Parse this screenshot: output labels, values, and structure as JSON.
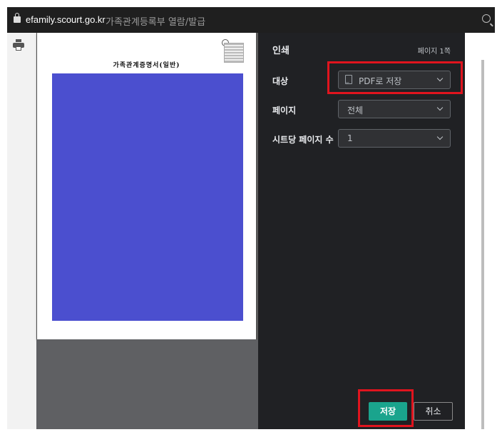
{
  "browser": {
    "url": "efamily.scourt.go.kr",
    "page_title": "가족관계등록부 열람/발급"
  },
  "preview": {
    "document_title": "가족관계증명서(일반)",
    "block_color": "#4b4fcf"
  },
  "print_dialog": {
    "heading": "인쇄",
    "page_count": "페이지 1쪽",
    "destination": {
      "label": "대상",
      "value": "PDF로 저장"
    },
    "pages": {
      "label": "페이지",
      "value": "전체"
    },
    "pages_per_sheet": {
      "label": "시트당 페이지 수",
      "value": "1"
    },
    "save_label": "저장",
    "cancel_label": "취소"
  },
  "colors": {
    "highlight": "#e0141e",
    "save_button": "#1aa48d",
    "dialog_bg": "#202124"
  },
  "icons": [
    "lock-icon",
    "zoom-icon",
    "printer-icon",
    "pdf-file-icon",
    "chevron-down-icon"
  ]
}
